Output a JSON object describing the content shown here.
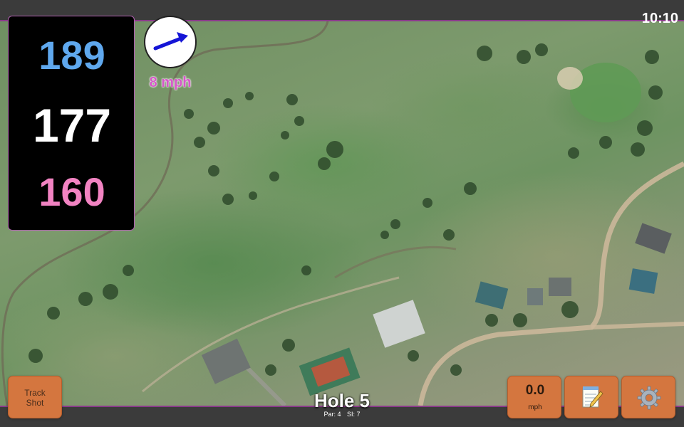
{
  "status": {
    "time": "10:10"
  },
  "distances": {
    "back": "189",
    "middle": "177",
    "front": "160"
  },
  "wind": {
    "speed": "8 mph",
    "direction_icon": "wind-arrow-icon"
  },
  "hole": {
    "title": "Hole 5",
    "par": "Par: 4",
    "stroke_index": "SI: 7"
  },
  "buttons": {
    "track_shot": [
      "Track",
      "Shot"
    ],
    "speed_value": "0.0",
    "speed_unit": "mph",
    "notes_icon": "notepad-icon",
    "settings_icon": "gear-icon"
  },
  "colors": {
    "back": "#5fa8ee",
    "middle": "#ffffff",
    "front": "#f283c2",
    "wind_text": "#d658c9",
    "button": "#d4763f",
    "accent_border": "#8a3a8a"
  }
}
